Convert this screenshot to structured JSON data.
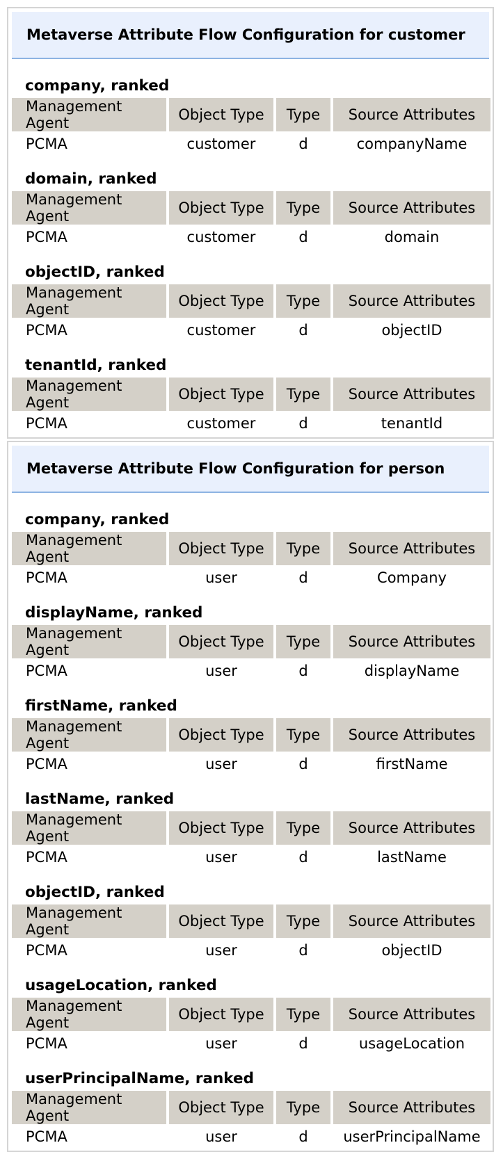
{
  "headers": [
    "Management Agent",
    "Object Type",
    "Type",
    "Source Attributes"
  ],
  "panels": [
    {
      "title": "Metaverse Attribute Flow Configuration for customer",
      "sections": [
        {
          "title": "company, ranked",
          "row": [
            "PCMA",
            "customer",
            "d",
            "companyName"
          ]
        },
        {
          "title": "domain, ranked",
          "row": [
            "PCMA",
            "customer",
            "d",
            "domain"
          ]
        },
        {
          "title": "objectID, ranked",
          "row": [
            "PCMA",
            "customer",
            "d",
            "objectID"
          ]
        },
        {
          "title": "tenantId, ranked",
          "row": [
            "PCMA",
            "customer",
            "d",
            "tenantId"
          ]
        }
      ]
    },
    {
      "title": "Metaverse Attribute Flow Configuration for person",
      "sections": [
        {
          "title": "company, ranked",
          "row": [
            "PCMA",
            "user",
            "d",
            "Company"
          ]
        },
        {
          "title": "displayName, ranked",
          "row": [
            "PCMA",
            "user",
            "d",
            "displayName"
          ]
        },
        {
          "title": "firstName, ranked",
          "row": [
            "PCMA",
            "user",
            "d",
            "firstName"
          ]
        },
        {
          "title": "lastName, ranked",
          "row": [
            "PCMA",
            "user",
            "d",
            "lastName"
          ]
        },
        {
          "title": "objectID, ranked",
          "row": [
            "PCMA",
            "user",
            "d",
            "objectID"
          ]
        },
        {
          "title": "usageLocation, ranked",
          "row": [
            "PCMA",
            "user",
            "d",
            "usageLocation"
          ]
        },
        {
          "title": "userPrincipalName, ranked",
          "row": [
            "PCMA",
            "user",
            "d",
            "userPrincipalName"
          ]
        }
      ]
    }
  ]
}
